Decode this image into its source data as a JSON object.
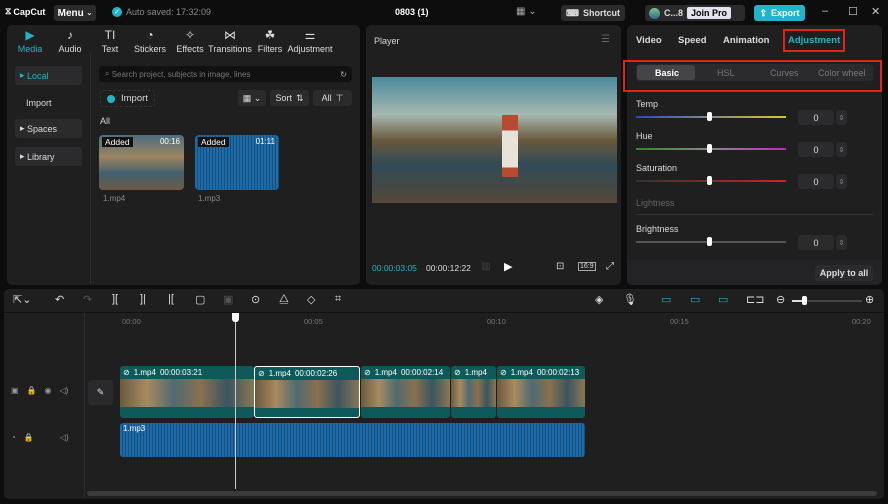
{
  "app": {
    "logo": "CapCut",
    "menu": "Menu",
    "autosave": "Auto saved: 17:32:09",
    "project_title": "0803 (1)",
    "shortcut": "Shortcut",
    "user": "C...8",
    "join_pro": "Join Pro",
    "export": "Export"
  },
  "media_tools": [
    {
      "label": "Media",
      "icon": "media-icon",
      "glyph": "▶",
      "active": true
    },
    {
      "label": "Audio",
      "icon": "audio-icon",
      "glyph": "♪"
    },
    {
      "label": "Text",
      "icon": "text-icon",
      "glyph": "TI"
    },
    {
      "label": "Stickers",
      "icon": "stickers-icon",
      "glyph": "◔"
    },
    {
      "label": "Effects",
      "icon": "effects-icon",
      "glyph": "✧"
    },
    {
      "label": "Transitions",
      "icon": "transitions-icon",
      "glyph": "⋈"
    },
    {
      "label": "Filters",
      "icon": "filters-icon",
      "glyph": "☘"
    },
    {
      "label": "Adjustment",
      "icon": "adjustment-icon",
      "glyph": "⚌"
    }
  ],
  "sidebar": {
    "local": "Local",
    "import": "Import",
    "spaces": "Spaces",
    "library": "Library"
  },
  "media": {
    "search_placeholder": "Search project, subjects in image, lines",
    "import": "Import",
    "sort": "Sort",
    "all_filter": "All",
    "section": "All",
    "items": [
      {
        "badge": "Added",
        "duration": "00:16",
        "name": "1.mp4"
      },
      {
        "badge": "Added",
        "duration": "01:11",
        "name": "1.mp3"
      }
    ]
  },
  "player": {
    "title": "Player",
    "current": "00:00:03:05",
    "total": "00:00:12:22",
    "ratio": "16:9"
  },
  "adjust": {
    "tabs": [
      "Video",
      "Speed",
      "Animation",
      "Adjustment"
    ],
    "active_tab": "Adjustment",
    "subtabs": [
      "Basic",
      "HSL",
      "Curves",
      "Color wheel"
    ],
    "active_subtab": "Basic",
    "sliders": [
      {
        "label": "Temp",
        "value": "0"
      },
      {
        "label": "Hue",
        "value": "0"
      },
      {
        "label": "Saturation",
        "value": "0"
      }
    ],
    "lightness_section": "Lightness",
    "brightness": {
      "label": "Brightness",
      "value": "0"
    },
    "apply_all": "Apply to all"
  },
  "timeline": {
    "ticks": [
      "00:00",
      "00:05",
      "00:10",
      "00:15",
      "00:20"
    ],
    "clips": [
      {
        "name": "1.mp4",
        "dur": "00:00:03:21"
      },
      {
        "name": "1.mp4",
        "dur": "00:00:02:26"
      },
      {
        "name": "1.mp4",
        "dur": "00:00:02:14"
      },
      {
        "name": "1.mp4",
        "dur": ""
      },
      {
        "name": "1.mp4",
        "dur": "00:00:02:13"
      }
    ],
    "audio": "1.mp3",
    "zoom_level": 0.08
  }
}
